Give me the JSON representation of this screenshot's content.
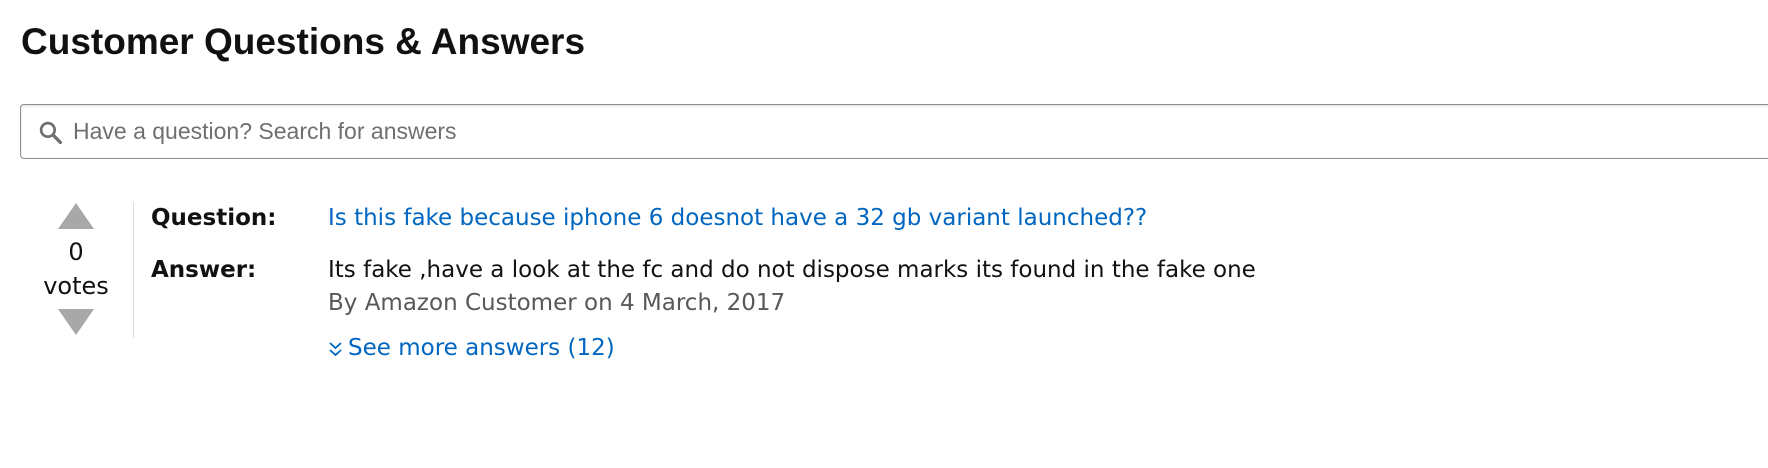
{
  "page": {
    "title": "Customer Questions & Answers"
  },
  "search": {
    "placeholder": "Have a question? Search for answers",
    "value": "",
    "icon": "search-icon"
  },
  "qa": {
    "votes": {
      "count": "0",
      "label": "votes",
      "up_icon": "triangle-up-icon",
      "down_icon": "triangle-down-icon"
    },
    "question_label": "Question:",
    "question_text": "Is this fake because iphone 6 doesnot have a 32 gb variant launched??",
    "answer_label": "Answer:",
    "answer_text": "Its fake ,have a look at the fc and do not dispose marks its found in the fake one",
    "byline": "By Amazon Customer on 4 March, 2017",
    "see_more": "See more answers (12)",
    "see_more_icon": "double-chevron-down-icon"
  },
  "colors": {
    "link": "#0066c0",
    "vote_arrow": "#a8a8a8",
    "byline": "#565959"
  }
}
